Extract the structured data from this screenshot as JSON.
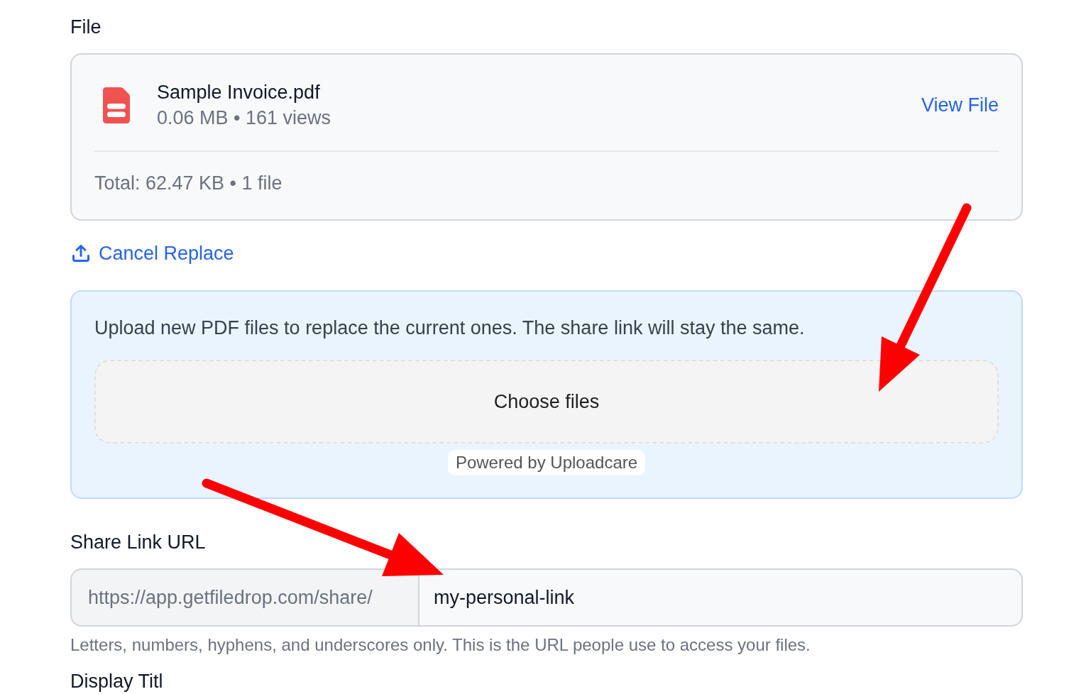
{
  "file_section": {
    "label": "File",
    "files": [
      {
        "name": "Sample Invoice.pdf",
        "meta": "0.06 MB • 161 views",
        "action": "View File"
      }
    ],
    "total": "Total: 62.47 KB • 1 file"
  },
  "replace_toggle": {
    "label": "Cancel Replace"
  },
  "upload_panel": {
    "message": "Upload new PDF files to replace the current ones. The share link will stay the same.",
    "dropzone_label": "Choose files",
    "powered_by": "Powered by Uploadcare"
  },
  "share_link": {
    "label": "Share Link URL",
    "prefix": "https://app.getfiledrop.com/share/",
    "value": "my-personal-link",
    "hint": "Letters, numbers, hyphens, and underscores only. This is the URL people use to access your files."
  },
  "next_field": {
    "label": "Display Titl"
  },
  "annotations": [
    {
      "kind": "arrow"
    },
    {
      "kind": "arrow"
    }
  ]
}
